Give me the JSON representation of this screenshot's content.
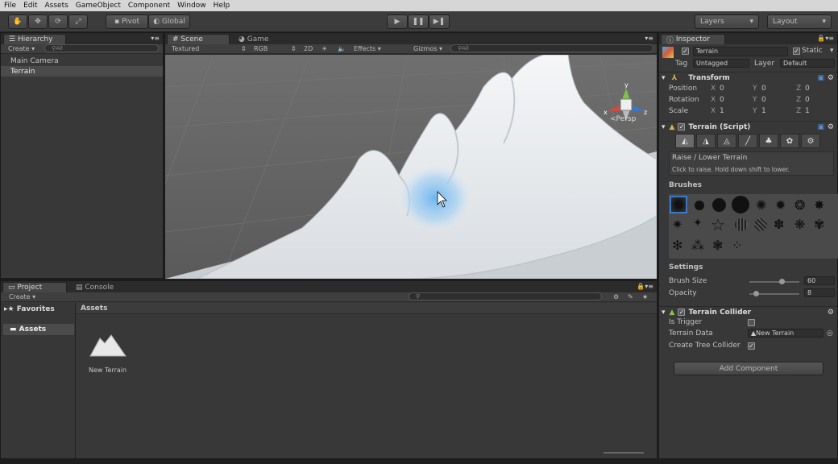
{
  "menu": [
    "File",
    "Edit",
    "Assets",
    "GameObject",
    "Component",
    "Window",
    "Help"
  ],
  "toolbar": {
    "pivot": "Pivot",
    "global": "Global",
    "layers": "Layers",
    "layout": "Layout"
  },
  "hierarchy": {
    "tab": "Hierarchy",
    "create": "Create",
    "search": "All",
    "items": [
      "Main Camera",
      "Terrain"
    ]
  },
  "scene": {
    "tab_scene": "Scene",
    "tab_game": "Game",
    "shading": "Textured",
    "rgb": "RGB",
    "mode2d": "2D",
    "effects": "Effects",
    "gizmos": "Gizmos",
    "search": "All",
    "persp": "Persp",
    "axis": {
      "x": "x",
      "y": "y",
      "z": "z"
    }
  },
  "project": {
    "tab": "Project",
    "tab_console": "Console",
    "create": "Create",
    "favorites": "Favorites",
    "assets": "Assets",
    "assets_header": "Assets",
    "asset_item": "New Terrain"
  },
  "inspector": {
    "tab": "Inspector",
    "object_name": "Terrain",
    "static": "Static",
    "tag_label": "Tag",
    "tag": "Untagged",
    "layer_label": "Layer",
    "layer": "Default",
    "transform": {
      "title": "Transform",
      "rows": [
        {
          "label": "Position",
          "x": "0",
          "y": "0",
          "z": "0"
        },
        {
          "label": "Rotation",
          "x": "0",
          "y": "0",
          "z": "0"
        },
        {
          "label": "Scale",
          "x": "1",
          "y": "1",
          "z": "1"
        }
      ]
    },
    "terrain": {
      "title": "Terrain (Script)",
      "tool_title": "Raise / Lower Terrain",
      "tool_hint": "Click to raise. Hold down shift to lower.",
      "brushes": "Brushes",
      "settings": "Settings",
      "brush_size_label": "Brush Size",
      "brush_size": "60",
      "opacity_label": "Opacity",
      "opacity": "8",
      "brush_size_fraction": 0.6,
      "opacity_fraction": 0.08
    },
    "collider": {
      "title": "Terrain Collider",
      "is_trigger": "Is Trigger",
      "terrain_data": "Terrain Data",
      "terrain_data_value": "New Terrain",
      "create_tree": "Create Tree Collider",
      "check": "✓"
    },
    "add_component": "Add Component"
  },
  "axes_labels": {
    "x": "X",
    "y": "Y",
    "z": "Z"
  },
  "colors": {
    "accent": "#3d7ccc",
    "panel": "#383838",
    "selection": "#4b4b4b"
  }
}
